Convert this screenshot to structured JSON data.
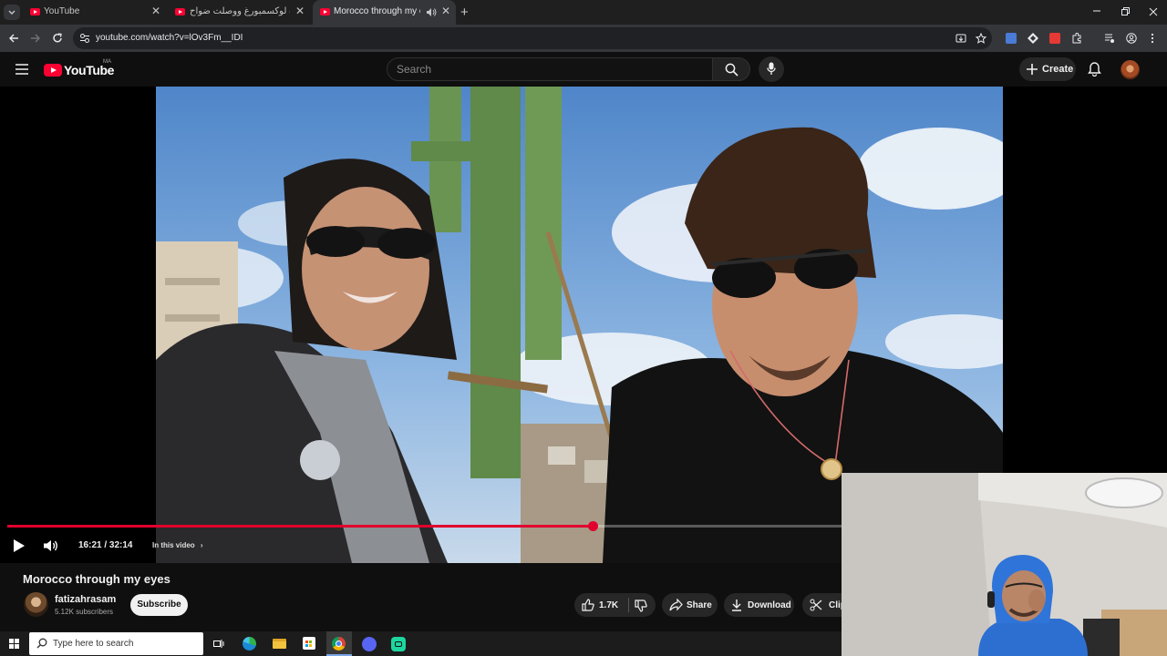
{
  "browser": {
    "tabs": [
      {
        "title": "YouTube",
        "active": false
      },
      {
        "title": "عبرت لوكسمبورغ ووصلت ضواح...",
        "active": false
      },
      {
        "title": "Morocco through my eyes",
        "active": true
      }
    ],
    "url": "youtube.com/watch?v=lOv3Fm__IDI"
  },
  "youtube": {
    "logo_text": "YouTube",
    "country_code": "MA",
    "search_placeholder": "Search",
    "create_label": "Create"
  },
  "player": {
    "progress_fraction": 0.5077,
    "time_display": "16:21 / 32:14",
    "chapter_label": "In this video",
    "chapter_chevron": "›"
  },
  "video": {
    "title": "Morocco through my eyes",
    "channel_name": "fatizahrasam",
    "subscribers": "5.12K subscribers",
    "subscribe_label": "Subscribe",
    "like_count": "1.7K",
    "share_label": "Share",
    "download_label": "Download",
    "clip_label": "Clip"
  },
  "taskbar": {
    "search_placeholder": "Type here to search"
  },
  "colors": {
    "yt_red": "#ff0033",
    "progress_red": "#e1002d",
    "background": "#0f0f0f"
  }
}
